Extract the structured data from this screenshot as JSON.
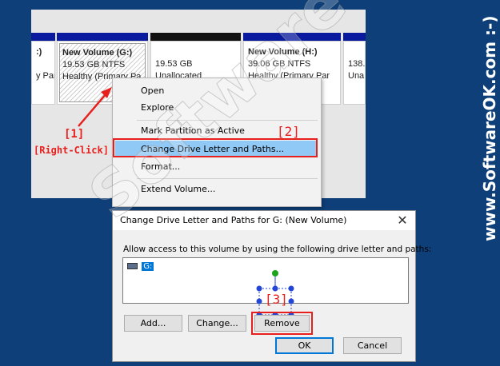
{
  "disk_panel": {
    "volumes": [
      {
        "name": ":)",
        "size": "",
        "status": "y Par"
      },
      {
        "name": "New Volume  (G:)",
        "size": "19.53 GB NTFS",
        "status": "Healthy (Primary Pa"
      },
      {
        "name": "",
        "size": "19.53 GB",
        "status": "Unallocated"
      },
      {
        "name": "New Volume  (H:)",
        "size": "39.06 GB NTFS",
        "status": "Healthy (Primary Par"
      },
      {
        "name": "",
        "size": "138.",
        "status": "Una"
      }
    ]
  },
  "context_menu": {
    "items": [
      {
        "label": "Open"
      },
      {
        "label": "Explore"
      },
      {
        "label": "Mark Partition as Active"
      },
      {
        "label": "Change Drive Letter and Paths..."
      },
      {
        "label": "Format..."
      },
      {
        "label": "Extend Volume..."
      }
    ],
    "highlighted_index": 3
  },
  "annotations": {
    "step1": "[1]",
    "step1_caption": "[Right-Click]",
    "step2": "[2]",
    "step3": "[3]"
  },
  "dialog": {
    "title": "Change Drive Letter and Paths for G: (New Volume)",
    "close_symbol": "✕",
    "instruction": "Allow access to this volume by using the following drive letter and paths:",
    "list_items": [
      {
        "label": "G:"
      }
    ],
    "buttons": {
      "add": "Add...",
      "change": "Change...",
      "remove": "Remove",
      "ok": "OK",
      "cancel": "Cancel"
    }
  },
  "watermark": {
    "diagonal": "SoftwareOK",
    "side": "www.SoftwareOK.com :-)"
  },
  "colors": {
    "background": "#0e3f78",
    "header_blue": "#0a1a9e",
    "header_black": "#111111",
    "highlight": "#90c8f6",
    "annotation_red": "#e8201d"
  }
}
